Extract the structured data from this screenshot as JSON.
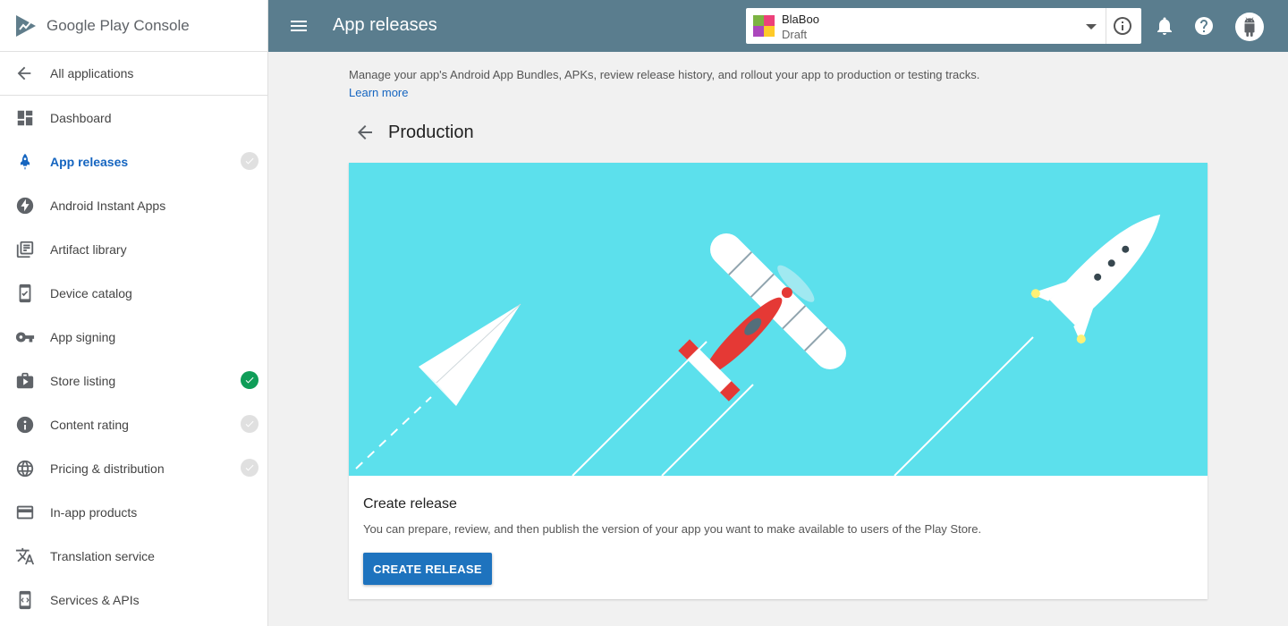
{
  "brand": {
    "name_bold": "Google Play",
    "name_rest": " Console"
  },
  "sidebar": {
    "back_label": "All applications",
    "items": [
      {
        "label": "Dashboard",
        "icon": "dashboard-icon",
        "status": "none"
      },
      {
        "label": "App releases",
        "icon": "rocket-icon",
        "status": "pending",
        "active": true
      },
      {
        "label": "Android Instant Apps",
        "icon": "bolt-icon",
        "status": "none"
      },
      {
        "label": "Artifact library",
        "icon": "library-icon",
        "status": "none"
      },
      {
        "label": "Device catalog",
        "icon": "device-icon",
        "status": "none"
      },
      {
        "label": "App signing",
        "icon": "key-icon",
        "status": "none"
      },
      {
        "label": "Store listing",
        "icon": "store-icon",
        "status": "done"
      },
      {
        "label": "Content rating",
        "icon": "rating-icon",
        "status": "pending"
      },
      {
        "label": "Pricing & distribution",
        "icon": "globe-icon",
        "status": "pending"
      },
      {
        "label": "In-app products",
        "icon": "card-icon",
        "status": "none"
      },
      {
        "label": "Translation service",
        "icon": "translate-icon",
        "status": "none"
      },
      {
        "label": "Services & APIs",
        "icon": "api-icon",
        "status": "none"
      }
    ]
  },
  "header": {
    "title": "App releases",
    "app_name": "BlaBoo",
    "app_status": "Draft"
  },
  "main": {
    "intro": "Manage your app's Android App Bundles, APKs, review release history, and rollout your app to production or testing tracks.",
    "learn_more": "Learn more",
    "page_title": "Production",
    "card": {
      "title": "Create release",
      "description": "You can prepare, review, and then publish the version of your app you want to make available to users of the Play Store.",
      "button": "CREATE RELEASE"
    }
  },
  "colors": {
    "topbar": "#5a7d8e",
    "accent": "#1565c0",
    "button": "#1e73be",
    "hero": "#5ce0ec",
    "done": "#0f9d58"
  }
}
